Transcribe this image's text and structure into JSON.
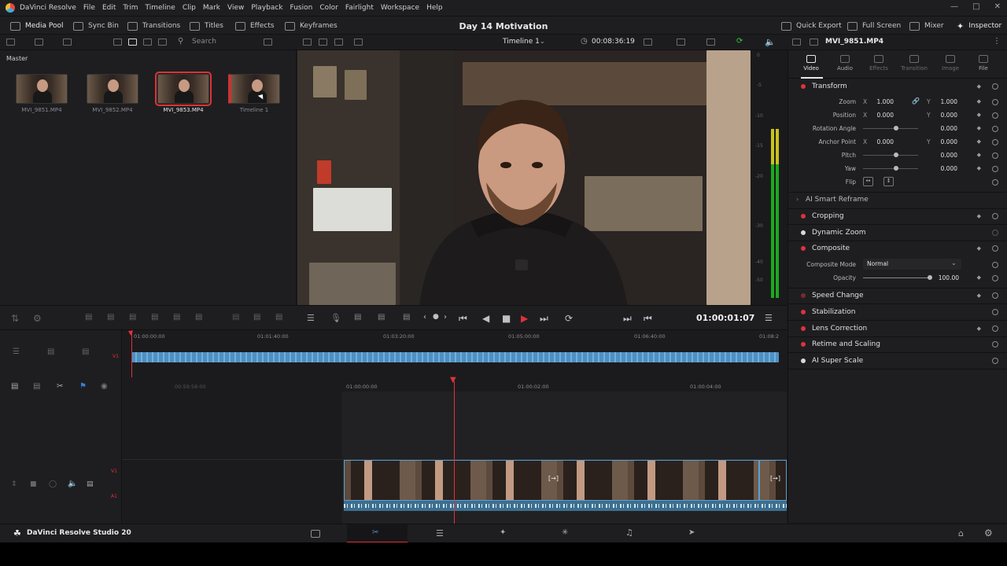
{
  "menubar": {
    "app_name": "DaVinci Resolve",
    "items": [
      "File",
      "Edit",
      "Trim",
      "Timeline",
      "Clip",
      "Mark",
      "View",
      "Playback",
      "Fusion",
      "Color",
      "Fairlight",
      "Workspace",
      "Help"
    ]
  },
  "toolbar": {
    "media_pool": "Media Pool",
    "sync_bin": "Sync Bin",
    "transitions": "Transitions",
    "titles": "Titles",
    "effects": "Effects",
    "keyframes": "Keyframes",
    "project_title": "Day 14 Motivation",
    "quick_export": "Quick Export",
    "full_screen": "Full Screen",
    "mixer": "Mixer",
    "inspector": "Inspector"
  },
  "subbar": {
    "search_placeholder": "Search",
    "timeline_name": "Timeline 1",
    "timeline_duration": "00:08:36:19",
    "inspector_clip": "MVI_9851.MP4"
  },
  "media_pool": {
    "bin": "Master",
    "clips": [
      {
        "name": "MVI_9851.MP4",
        "selected": false
      },
      {
        "name": "MVI_9852.MP4",
        "selected": false
      },
      {
        "name": "MVI_9853.MP4",
        "selected": true
      },
      {
        "name": "Timeline 1",
        "selected": false
      }
    ]
  },
  "meter_scale": [
    "0",
    "-5",
    "-10",
    "-15",
    "-20",
    "-30",
    "-40",
    "-50"
  ],
  "inspector": {
    "tabs": [
      {
        "label": "Video",
        "active": true
      },
      {
        "label": "Audio",
        "active": false
      },
      {
        "label": "Effects",
        "active": false
      },
      {
        "label": "Transition",
        "active": false
      },
      {
        "label": "Image",
        "active": false
      },
      {
        "label": "File",
        "active": false
      }
    ],
    "transform": {
      "title": "Transform",
      "zoom_label": "Zoom",
      "zoom_x": "1.000",
      "zoom_y": "1.000",
      "position_label": "Position",
      "position_x": "0.000",
      "position_y": "0.000",
      "rotation_label": "Rotation Angle",
      "rotation": "0.000",
      "anchor_label": "Anchor Point",
      "anchor_x": "0.000",
      "anchor_y": "0.000",
      "pitch_label": "Pitch",
      "pitch": "0.000",
      "yaw_label": "Yaw",
      "yaw": "0.000",
      "flip_label": "Flip",
      "x": "X",
      "y": "Y"
    },
    "ai_smart_reframe": "AI Smart Reframe",
    "cropping": "Cropping",
    "dynamic_zoom": "Dynamic Zoom",
    "composite": {
      "title": "Composite",
      "mode_label": "Composite Mode",
      "mode_value": "Normal",
      "opacity_label": "Opacity",
      "opacity_value": "100.00"
    },
    "speed_change": "Speed Change",
    "stabilization": "Stabilization",
    "lens_correction": "Lens Correction",
    "retime_scaling": "Retime and Scaling",
    "ai_super_scale": "AI Super Scale"
  },
  "transport": {
    "timecode": "01:00:01:07"
  },
  "mini_timeline": {
    "ruler": [
      "01:00:00:00",
      "01:01:40:00",
      "01:03:20:00",
      "01:05:00:00",
      "01:06:40:00",
      "01:08:2"
    ],
    "track": "V1"
  },
  "main_timeline": {
    "ruler": [
      "00:59:58:00",
      "01:00:00:00",
      "01:00:02:00",
      "01:00:04:00"
    ],
    "tracks": [
      "V1",
      "A1"
    ]
  },
  "bottombar": {
    "product": "DaVinci Resolve Studio 20"
  },
  "colors": {
    "accent_red": "#e0323a",
    "audio_blue": "#5a9fd4",
    "meter_green": "#1ea81e",
    "meter_yellow": "#c9c21c"
  }
}
